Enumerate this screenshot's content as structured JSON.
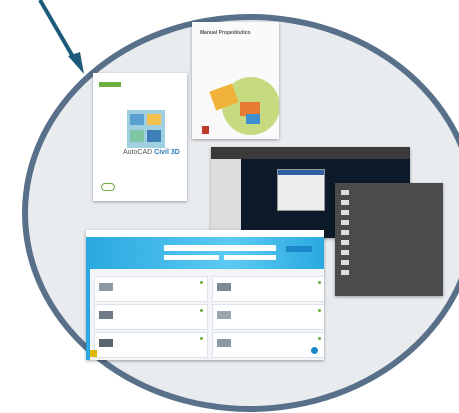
{
  "colors": {
    "circle_border": "#58708a",
    "arrow": "#1d5b7d",
    "accent_green": "#6cae3e",
    "web_blue": "#2aa9e0"
  },
  "doc_autocad": {
    "brand_prefix": "AutoCAD",
    "brand_suffix": "Civil 3D"
  },
  "doc_manual": {
    "title": "Manual Propedêutico"
  },
  "doc_webapp": {
    "cards": [
      {
        "thumb_color": "#8d9aa6"
      },
      {
        "thumb_color": "#7f8c98"
      },
      {
        "thumb_color": "#6e7a86"
      },
      {
        "thumb_color": "#9aa6b1"
      },
      {
        "thumb_color": "#5b6570"
      },
      {
        "thumb_color": "#8a96a2"
      }
    ]
  },
  "doc_layers": {
    "row_count": 9
  }
}
